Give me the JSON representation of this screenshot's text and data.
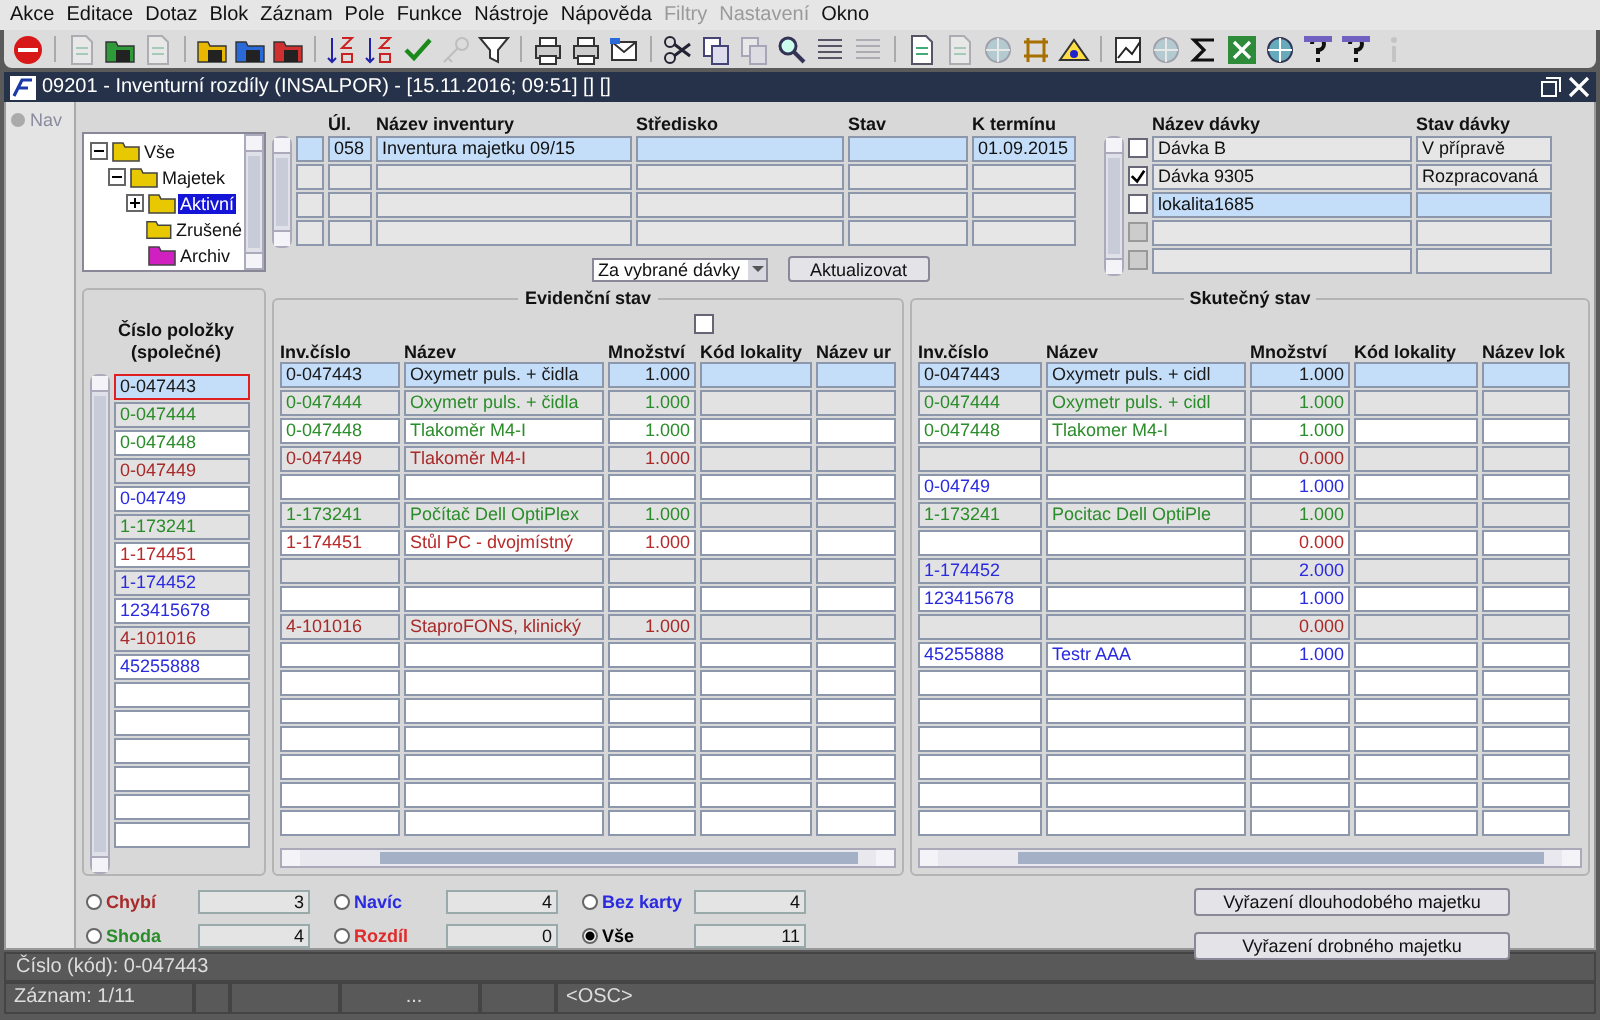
{
  "menu": [
    {
      "label": "Akce",
      "disabled": false
    },
    {
      "label": "Editace",
      "disabled": false
    },
    {
      "label": "Dotaz",
      "disabled": false
    },
    {
      "label": "Blok",
      "disabled": false
    },
    {
      "label": "Záznam",
      "disabled": false
    },
    {
      "label": "Pole",
      "disabled": false
    },
    {
      "label": "Funkce",
      "disabled": false
    },
    {
      "label": "Nástroje",
      "disabled": false
    },
    {
      "label": "Nápověda",
      "disabled": false
    },
    {
      "label": "Filtry",
      "disabled": true
    },
    {
      "label": "Nastavení",
      "disabled": true
    },
    {
      "label": "Okno",
      "disabled": false
    }
  ],
  "toolbar": [
    {
      "kind": "exit",
      "disabled": false
    },
    {
      "kind": "separator"
    },
    {
      "kind": "page",
      "disabled": true
    },
    {
      "kind": "folder",
      "color": "#2f9a3a",
      "disabled": false
    },
    {
      "kind": "page",
      "disabled": true
    },
    {
      "kind": "separator"
    },
    {
      "kind": "folder",
      "color": "#e8b800",
      "disabled": false
    },
    {
      "kind": "folder",
      "color": "#2a6ad8",
      "disabled": false
    },
    {
      "kind": "folder",
      "color": "#d03030",
      "disabled": false
    },
    {
      "kind": "separator"
    },
    {
      "kind": "sort",
      "disabled": false
    },
    {
      "kind": "sort",
      "disabled": false
    },
    {
      "kind": "check",
      "disabled": false
    },
    {
      "kind": "key",
      "disabled": true
    },
    {
      "kind": "filter",
      "disabled": false
    },
    {
      "kind": "separator"
    },
    {
      "kind": "printer",
      "disabled": false
    },
    {
      "kind": "printer",
      "disabled": false
    },
    {
      "kind": "mail",
      "disabled": false
    },
    {
      "kind": "separator"
    },
    {
      "kind": "scissors",
      "disabled": false
    },
    {
      "kind": "copy",
      "disabled": false
    },
    {
      "kind": "copy",
      "disabled": true
    },
    {
      "kind": "search",
      "disabled": false
    },
    {
      "kind": "list",
      "disabled": false
    },
    {
      "kind": "list",
      "disabled": true
    },
    {
      "kind": "separator"
    },
    {
      "kind": "page",
      "disabled": false
    },
    {
      "kind": "page",
      "disabled": true
    },
    {
      "kind": "globe",
      "disabled": true
    },
    {
      "kind": "grid",
      "disabled": false
    },
    {
      "kind": "triangle",
      "disabled": false
    },
    {
      "kind": "separator"
    },
    {
      "kind": "chart",
      "disabled": false
    },
    {
      "kind": "globe",
      "disabled": true
    },
    {
      "kind": "sigma",
      "disabled": false
    },
    {
      "kind": "sheet",
      "disabled": false
    },
    {
      "kind": "globe",
      "disabled": false
    },
    {
      "kind": "question",
      "disabled": false
    },
    {
      "kind": "question",
      "disabled": false
    },
    {
      "kind": "info",
      "disabled": true
    }
  ],
  "window": {
    "title": "09201 - Inventurní rozdíly (INSALPOR) - [15.11.2016; 09:51] [] []"
  },
  "nav_label": "Nav",
  "tree": [
    {
      "label": "Vše",
      "color": "#e8c800",
      "expanded": true,
      "selected": false,
      "children": [
        {
          "label": "Majetek",
          "color": "#e8c800",
          "expanded": true,
          "selected": false,
          "children": [
            {
              "label": "Aktivní",
              "color": "#e8c800",
              "expanded": false,
              "selected": true
            },
            {
              "label": "Zrušené",
              "color": "#e8c800",
              "selected": false
            },
            {
              "label": "Archiv",
              "color": "#d020c0",
              "selected": false
            }
          ]
        }
      ]
    }
  ],
  "inventory": {
    "columns": [
      "Úl.",
      "Název inventury",
      "Středisko",
      "Stav",
      "K termínu"
    ],
    "rows": [
      {
        "selected": true,
        "ul": "058",
        "name": "Inventura majetku 09/15",
        "due": "01.09.2015"
      },
      {
        "selected": false
      },
      {
        "selected": false
      },
      {
        "selected": false
      }
    ],
    "scope_dropdown": "Za vybrané dávky",
    "refresh_button": "Aktualizovat"
  },
  "batches": {
    "columns": [
      "Název dávky",
      "Stav dávky"
    ],
    "rows": [
      {
        "checked": false,
        "disabled": false,
        "selected": false,
        "name": "Dávka B",
        "state": "V přípravě"
      },
      {
        "checked": true,
        "disabled": false,
        "selected": false,
        "name": "Dávka 9305",
        "state": "Rozpracovaná"
      },
      {
        "checked": false,
        "disabled": false,
        "selected": true,
        "name": "lokalita1685"
      },
      {
        "checked": false,
        "disabled": true,
        "selected": false
      },
      {
        "checked": false,
        "disabled": true,
        "selected": false
      }
    ]
  },
  "items_header": "Číslo položky (společné)",
  "evidence": {
    "title": "Evidenční stav",
    "header_checkbox": {
      "checked": false
    },
    "columns": [
      "Inv.číslo",
      "Název",
      "Množství",
      "Kód lokality",
      "Název ur"
    ]
  },
  "actual": {
    "title": "Skutečný stav",
    "columns": [
      "Inv.číslo",
      "Název",
      "Množství",
      "Kód lokality",
      "Název lok"
    ]
  },
  "rows": [
    {
      "item": "0-047443",
      "color": "#1a1a1a",
      "selected": true,
      "evidence": {
        "inv": "0-047443",
        "name": "Oxymetr puls. + čidla",
        "qty": "1.000"
      },
      "actual": {
        "inv": "0-047443",
        "name": "Oxymetr puls. + cidl",
        "qty": "1.000"
      }
    },
    {
      "item": "0-047444",
      "color": "#2a8c2a",
      "selected": false,
      "evidence": {
        "inv": "0-047444",
        "name": "Oxymetr puls. + čidla",
        "qty": "1.000"
      },
      "actual": {
        "inv": "0-047444",
        "name": "Oxymetr puls. + cidl",
        "qty": "1.000"
      }
    },
    {
      "item": "0-047448",
      "color": "#2a8c2a",
      "selected": false,
      "evidence": {
        "inv": "0-047448",
        "name": "Tlakoměr M4-I",
        "qty": "1.000"
      },
      "actual": {
        "inv": "0-047448",
        "name": "Tlakomer M4-I",
        "qty": "1.000"
      }
    },
    {
      "item": "0-047449",
      "color": "#a82a2a",
      "selected": false,
      "evidence": {
        "inv": "0-047449",
        "name": "Tlakoměr M4-I",
        "qty": "1.000"
      },
      "actual": {
        "qty": "0.000"
      }
    },
    {
      "item": "0-04749",
      "color": "#2a2ae0",
      "selected": false,
      "evidence": {},
      "actual": {
        "inv": "0-04749",
        "qty": "1.000"
      }
    },
    {
      "item": "1-173241",
      "color": "#2a8c2a",
      "selected": false,
      "evidence": {
        "inv": "1-173241",
        "name": "Počítač Dell OptiPlex",
        "qty": "1.000"
      },
      "actual": {
        "inv": "1-173241",
        "name": "Pocitac Dell OptiPle",
        "qty": "1.000"
      }
    },
    {
      "item": "1-174451",
      "color": "#b82a2a",
      "selected": false,
      "evidence": {
        "inv": "1-174451",
        "name": "Stůl PC - dvojmístný",
        "qty": "1.000"
      },
      "actual": {
        "qty": "0.000"
      }
    },
    {
      "item": "1-174452",
      "color": "#2a2ae0",
      "selected": false,
      "evidence": {},
      "actual": {
        "inv": "1-174452",
        "qty": "2.000"
      }
    },
    {
      "item": "123415678",
      "color": "#2a2ae0",
      "selected": false,
      "evidence": {},
      "actual": {
        "inv": "123415678",
        "qty": "1.000"
      }
    },
    {
      "item": "4-101016",
      "color": "#a82a2a",
      "selected": false,
      "evidence": {
        "inv": "4-101016",
        "name": "StaproFONS, klinický",
        "qty": "1.000"
      },
      "actual": {
        "qty": "0.000"
      }
    },
    {
      "item": "45255888",
      "color": "#2a2ae0",
      "selected": false,
      "evidence": {},
      "actual": {
        "inv": "45255888",
        "name": "Testr AAA",
        "qty": "1.000"
      }
    },
    {
      "selected": false
    },
    {
      "selected": false
    },
    {
      "selected": false
    },
    {
      "selected": false
    },
    {
      "selected": false
    },
    {
      "selected": false
    }
  ],
  "filters": [
    {
      "label": "Chybí",
      "count": "3",
      "color": "#a82a2a",
      "selected": false
    },
    {
      "label": "Shoda",
      "count": "4",
      "color": "#2a8c2a",
      "selected": false
    },
    {
      "label": "Navíc",
      "count": "4",
      "color": "#2a2ae0",
      "selected": false
    },
    {
      "label": "Rozdíl",
      "count": "0",
      "color": "#e02a2a",
      "selected": false
    },
    {
      "label": "Bez karty",
      "count": "4",
      "color": "#2a2ae0",
      "selected": false
    },
    {
      "label": "Vše",
      "count": "11",
      "color": "#000000",
      "selected": true
    }
  ],
  "actions": [
    "Vyřazení dlouhodobého majetku",
    "Vyřazení drobného majetku"
  ],
  "status": {
    "message": "Číslo (kód): 0-047443",
    "record": "Záznam: 1/11",
    "more": "...",
    "mode": "<OSC>"
  }
}
